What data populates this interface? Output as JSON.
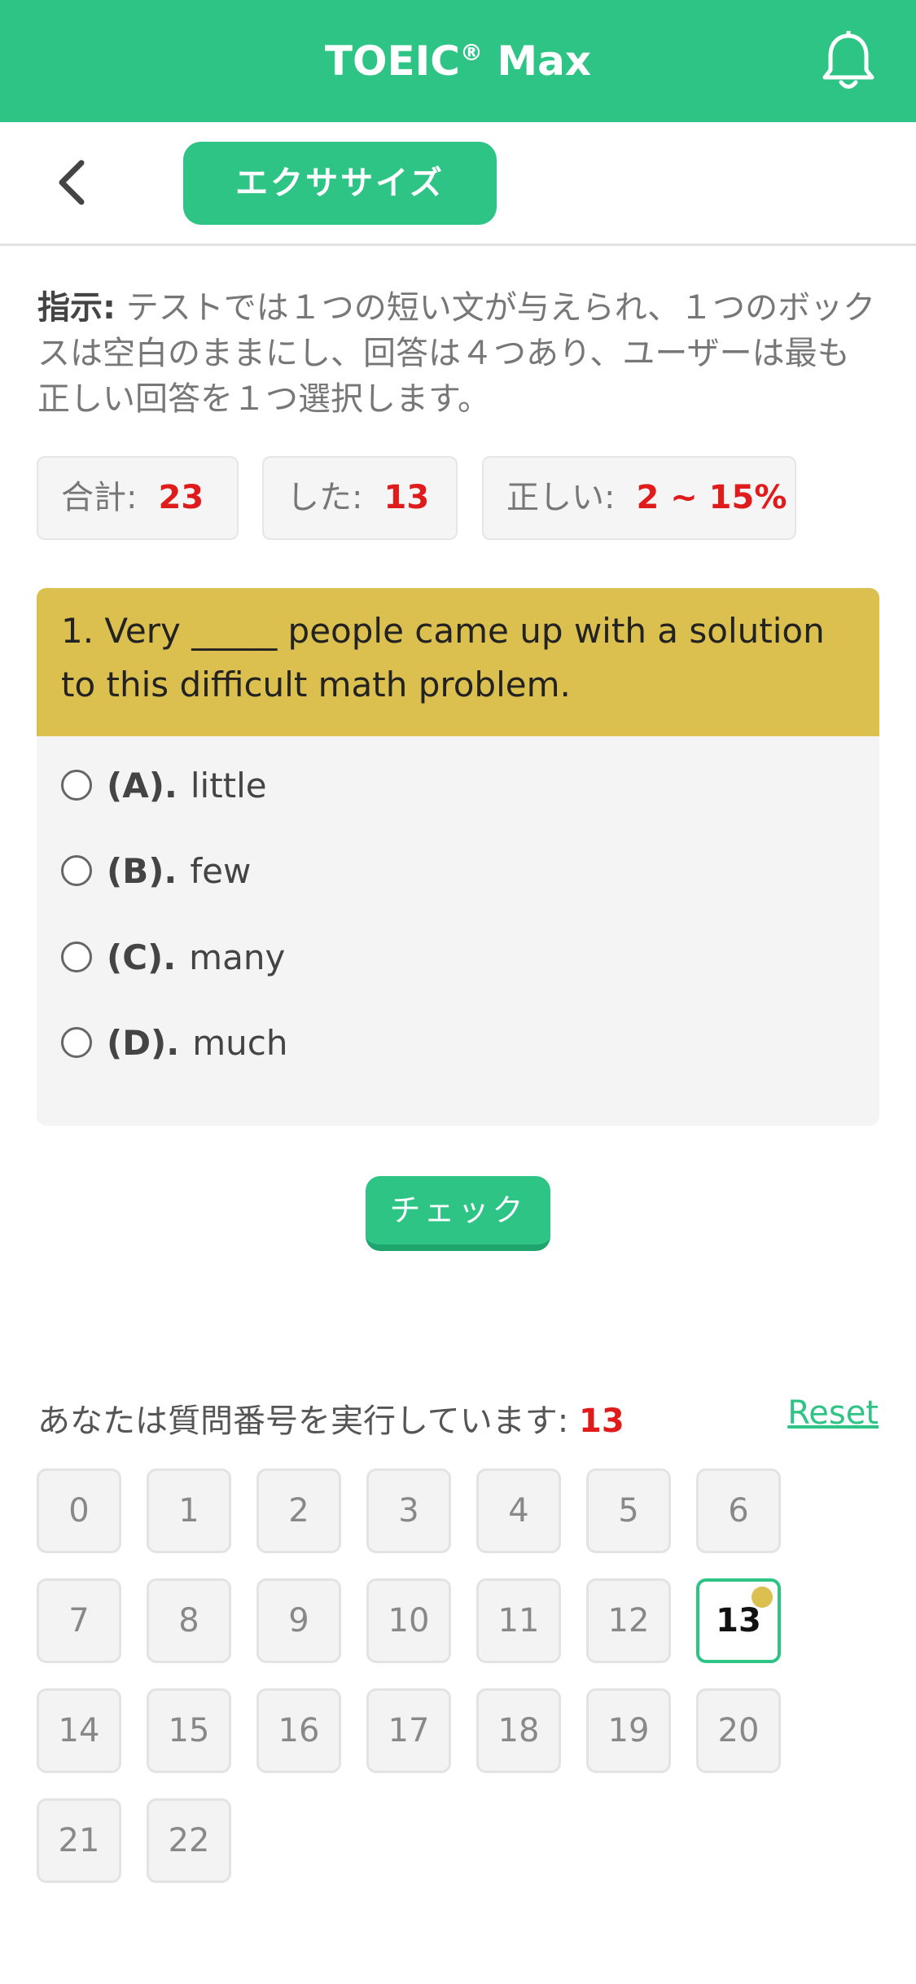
{
  "header": {
    "title": "TOEIC",
    "title_sup": "®",
    "title_suffix": " Max",
    "brand_color": "#2ec486",
    "bell_icon": "bell-icon"
  },
  "subbar": {
    "back_icon": "chevron-left-icon",
    "tab_label": "エクササイズ"
  },
  "instruction": {
    "label": "指示:",
    "text": " テストでは１つの短い文が与えられ、１つのボックスは空白のままにし、回答は４つあり、ユーザーは最も正しい回答を１つ選択します。"
  },
  "stats": {
    "total_label": "合計:",
    "total_value": "23",
    "done_label": "した:",
    "done_value": "13",
    "correct_label": "正しい:",
    "correct_value": "2 ~ 15%"
  },
  "question": {
    "text": "1. Very _____ people came up with a solution to this difficult math problem.",
    "options": [
      {
        "letter": "(A).",
        "text": "little"
      },
      {
        "letter": "(B).",
        "text": "few"
      },
      {
        "letter": "(C).",
        "text": "many"
      },
      {
        "letter": "(D).",
        "text": "much"
      }
    ]
  },
  "check_label": "チェック",
  "progress": {
    "label": "あなたは質問番号を実行しています: ",
    "current": "13",
    "reset_label": "Reset"
  },
  "grid": [
    "0",
    "1",
    "2",
    "3",
    "4",
    "5",
    "6",
    "7",
    "8",
    "9",
    "10",
    "11",
    "12",
    "13",
    "14",
    "15",
    "16",
    "17",
    "18",
    "19",
    "20",
    "21",
    "22"
  ],
  "grid_active": "13"
}
